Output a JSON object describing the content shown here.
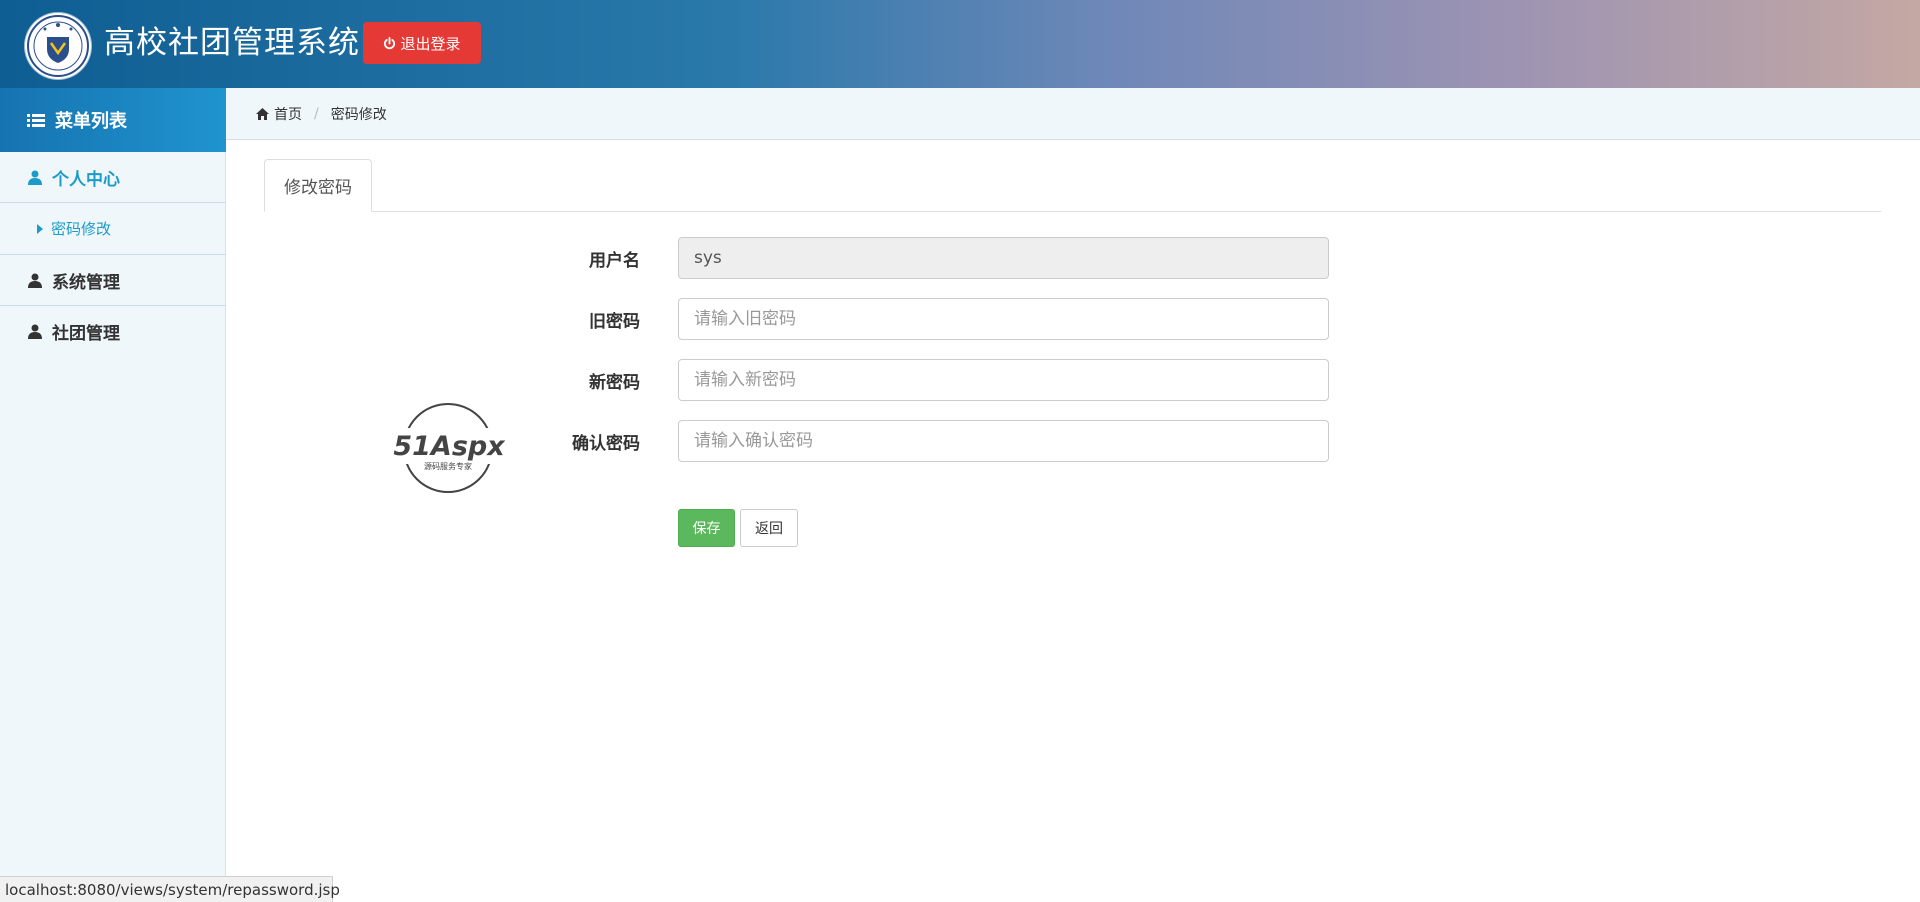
{
  "header": {
    "app_title": "高校社团管理系统",
    "logout_label": "退出登录",
    "colors": {
      "logout": "#e53935"
    }
  },
  "sidebar": {
    "menu_title": "菜单列表",
    "items": [
      {
        "label": "个人中心",
        "active": true,
        "icon": "user-icon",
        "children": [
          {
            "label": "密码修改",
            "icon": "caret-right-icon"
          }
        ]
      },
      {
        "label": "系统管理",
        "icon": "user-icon"
      },
      {
        "label": "社团管理",
        "icon": "user-icon"
      }
    ]
  },
  "breadcrumb": {
    "home": "首页",
    "current": "密码修改"
  },
  "tabs": [
    {
      "label": "修改密码",
      "active": true
    }
  ],
  "watermark": {
    "brand": "51Aspx",
    "tagline": "源码服务专家"
  },
  "form": {
    "username": {
      "label": "用户名",
      "value": "sys"
    },
    "old_password": {
      "label": "旧密码",
      "placeholder": "请输入旧密码"
    },
    "new_password": {
      "label": "新密码",
      "placeholder": "请输入新密码"
    },
    "confirm_password": {
      "label": "确认密码",
      "placeholder": "请输入确认密码"
    },
    "save_label": "保存",
    "back_label": "返回"
  },
  "statusbar": {
    "url": "localhost:8080/views/system/repassword.jsp"
  }
}
